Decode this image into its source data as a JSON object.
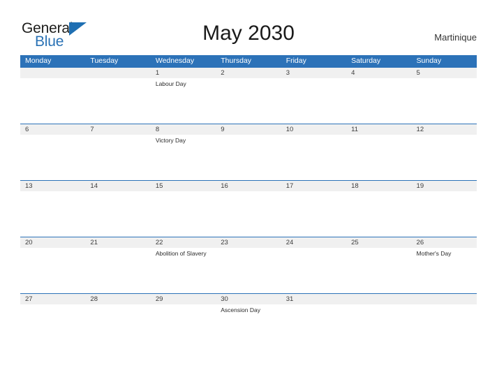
{
  "brand": {
    "name_part1": "General",
    "name_part2": "Blue",
    "triangle_color": "#1f6fb2",
    "text_color": "#1d1d1b",
    "blue_color": "#2a72b5"
  },
  "header": {
    "title": "May 2030",
    "region": "Martinique"
  },
  "theme": {
    "header_blue": "#2c72b8",
    "row_band_gray": "#f0f0f0",
    "rule_blue": "#2c72b8",
    "page_background": "#ffffff"
  },
  "calendar": {
    "month": "May",
    "year": "2030",
    "weekday_headers": [
      "Monday",
      "Tuesday",
      "Wednesday",
      "Thursday",
      "Friday",
      "Saturday",
      "Sunday"
    ],
    "weeks": [
      [
        {
          "date": "",
          "event": ""
        },
        {
          "date": "",
          "event": ""
        },
        {
          "date": "1",
          "event": "Labour Day"
        },
        {
          "date": "2",
          "event": ""
        },
        {
          "date": "3",
          "event": ""
        },
        {
          "date": "4",
          "event": ""
        },
        {
          "date": "5",
          "event": ""
        }
      ],
      [
        {
          "date": "6",
          "event": ""
        },
        {
          "date": "7",
          "event": ""
        },
        {
          "date": "8",
          "event": "Victory Day"
        },
        {
          "date": "9",
          "event": ""
        },
        {
          "date": "10",
          "event": ""
        },
        {
          "date": "11",
          "event": ""
        },
        {
          "date": "12",
          "event": ""
        }
      ],
      [
        {
          "date": "13",
          "event": ""
        },
        {
          "date": "14",
          "event": ""
        },
        {
          "date": "15",
          "event": ""
        },
        {
          "date": "16",
          "event": ""
        },
        {
          "date": "17",
          "event": ""
        },
        {
          "date": "18",
          "event": ""
        },
        {
          "date": "19",
          "event": ""
        }
      ],
      [
        {
          "date": "20",
          "event": ""
        },
        {
          "date": "21",
          "event": ""
        },
        {
          "date": "22",
          "event": "Abolition of Slavery"
        },
        {
          "date": "23",
          "event": ""
        },
        {
          "date": "24",
          "event": ""
        },
        {
          "date": "25",
          "event": ""
        },
        {
          "date": "26",
          "event": "Mother's Day"
        }
      ],
      [
        {
          "date": "27",
          "event": ""
        },
        {
          "date": "28",
          "event": ""
        },
        {
          "date": "29",
          "event": ""
        },
        {
          "date": "30",
          "event": "Ascension Day"
        },
        {
          "date": "31",
          "event": ""
        },
        {
          "date": "",
          "event": ""
        },
        {
          "date": "",
          "event": ""
        }
      ]
    ]
  }
}
